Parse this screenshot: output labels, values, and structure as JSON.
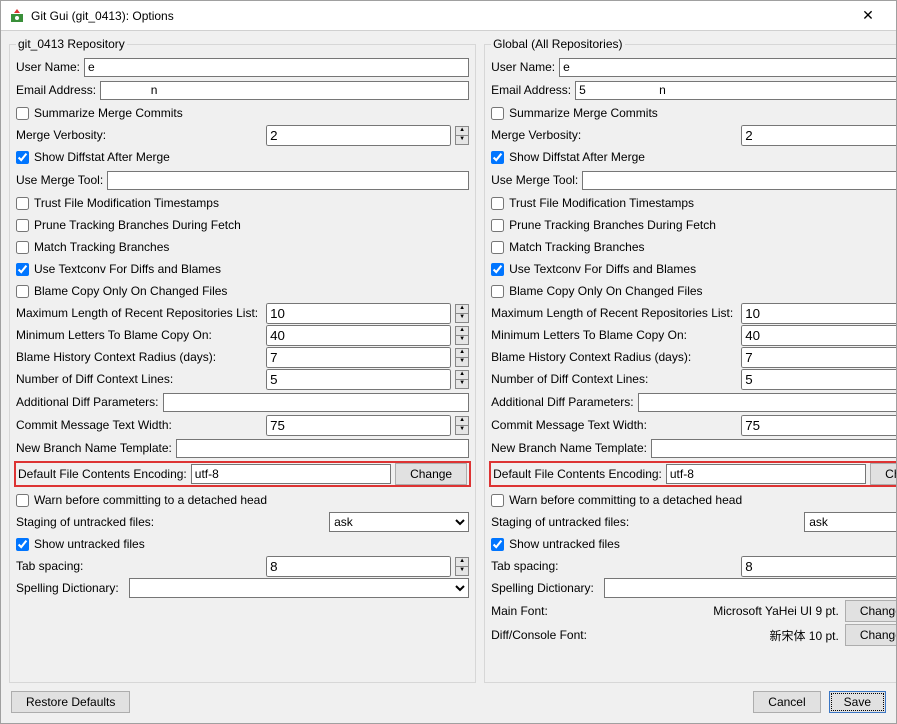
{
  "window": {
    "title": "Git Gui (git_0413): Options",
    "close_glyph": "✕"
  },
  "left": {
    "legend": "git_0413 Repository",
    "user_name_lbl": "User Name:",
    "user_name_val": "e",
    "email_lbl": "Email Address:",
    "email_val": "              n",
    "summarize_lbl": "Summarize Merge Commits",
    "merge_verbosity_lbl": "Merge Verbosity:",
    "merge_verbosity_val": "2",
    "diffstat_lbl": "Show Diffstat After Merge",
    "use_merge_tool_lbl": "Use Merge Tool:",
    "use_merge_tool_val": "",
    "trust_mtime_lbl": "Trust File Modification Timestamps",
    "prune_lbl": "Prune Tracking Branches During Fetch",
    "match_track_lbl": "Match Tracking Branches",
    "textconv_lbl": "Use Textconv For Diffs and Blames",
    "blame_changed_lbl": "Blame Copy Only On Changed Files",
    "max_recent_lbl": "Maximum Length of Recent Repositories List:",
    "max_recent_val": "10",
    "min_blame_lbl": "Minimum Letters To Blame Copy On:",
    "min_blame_val": "40",
    "blame_hist_lbl": "Blame History Context Radius (days):",
    "blame_hist_val": "7",
    "diff_ctx_lbl": "Number of Diff Context Lines:",
    "diff_ctx_val": "5",
    "add_diff_lbl": "Additional Diff Parameters:",
    "add_diff_val": "",
    "commit_w_lbl": "Commit Message Text Width:",
    "commit_w_val": "75",
    "branch_tmpl_lbl": "New Branch Name Template:",
    "branch_tmpl_val": "",
    "encoding_lbl": "Default File Contents Encoding:",
    "encoding_val": "utf-8",
    "change_btn": "Change",
    "warn_detached_lbl": "Warn before committing to a detached head",
    "staging_lbl": "Staging of untracked files:",
    "staging_val": "ask",
    "show_untracked_lbl": "Show untracked files",
    "tab_lbl": "Tab spacing:",
    "tab_val": "8",
    "spell_lbl": "Spelling Dictionary:",
    "spell_val": ""
  },
  "right": {
    "legend": "Global (All Repositories)",
    "user_name_lbl": "User Name:",
    "user_name_val": "e",
    "email_lbl": "Email Address:",
    "email_val": "5                      n",
    "summarize_lbl": "Summarize Merge Commits",
    "merge_verbosity_lbl": "Merge Verbosity:",
    "merge_verbosity_val": "2",
    "diffstat_lbl": "Show Diffstat After Merge",
    "use_merge_tool_lbl": "Use Merge Tool:",
    "use_merge_tool_val": "",
    "trust_mtime_lbl": "Trust File Modification Timestamps",
    "prune_lbl": "Prune Tracking Branches During Fetch",
    "match_track_lbl": "Match Tracking Branches",
    "textconv_lbl": "Use Textconv For Diffs and Blames",
    "blame_changed_lbl": "Blame Copy Only On Changed Files",
    "max_recent_lbl": "Maximum Length of Recent Repositories List:",
    "max_recent_val": "10",
    "min_blame_lbl": "Minimum Letters To Blame Copy On:",
    "min_blame_val": "40",
    "blame_hist_lbl": "Blame History Context Radius (days):",
    "blame_hist_val": "7",
    "diff_ctx_lbl": "Number of Diff Context Lines:",
    "diff_ctx_val": "5",
    "add_diff_lbl": "Additional Diff Parameters:",
    "add_diff_val": "",
    "commit_w_lbl": "Commit Message Text Width:",
    "commit_w_val": "75",
    "branch_tmpl_lbl": "New Branch Name Template:",
    "branch_tmpl_val": "",
    "encoding_lbl": "Default File Contents Encoding:",
    "encoding_val": "utf-8",
    "change_btn": "Change",
    "warn_detached_lbl": "Warn before committing to a detached head",
    "staging_lbl": "Staging of untracked files:",
    "staging_val": "ask",
    "show_untracked_lbl": "Show untracked files",
    "tab_lbl": "Tab spacing:",
    "tab_val": "8",
    "spell_lbl": "Spelling Dictionary:",
    "spell_val": "",
    "main_font_lbl": "Main Font:",
    "main_font_val": "Microsoft YaHei UI 9 pt.",
    "diff_font_lbl": "Diff/Console Font:",
    "diff_font_val": "新宋体 10 pt.",
    "change_font_btn": "Change Font"
  },
  "footer": {
    "restore": "Restore Defaults",
    "cancel": "Cancel",
    "save": "Save"
  }
}
